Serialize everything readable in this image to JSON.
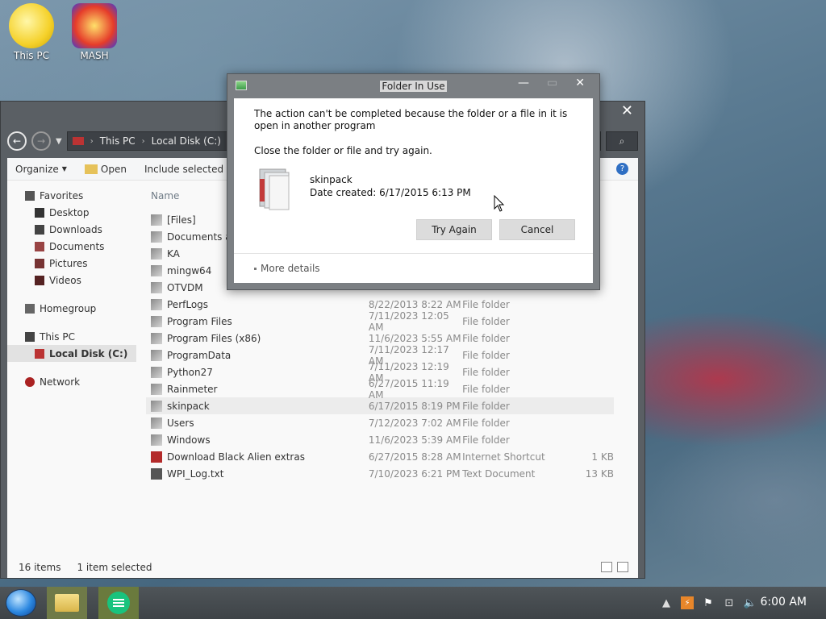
{
  "desktop": {
    "icons": [
      {
        "label": "This PC"
      },
      {
        "label": "MASH"
      }
    ]
  },
  "explorer": {
    "close_glyph": "✕",
    "address": {
      "crumbs": [
        "This PC",
        "Local Disk (C:)"
      ],
      "sep": "›"
    },
    "toolbar": {
      "organize": "Organize",
      "open": "Open",
      "include": "Include selected"
    },
    "nav": {
      "favorites": "Favorites",
      "desktop": "Desktop",
      "downloads": "Downloads",
      "documents": "Documents",
      "pictures": "Pictures",
      "videos": "Videos",
      "homegroup": "Homegroup",
      "this_pc": "This PC",
      "local_disk": "Local Disk (C:)",
      "network": "Network"
    },
    "columns": {
      "name": "Name"
    },
    "files": [
      {
        "name": "[Files]",
        "date": "",
        "type": "",
        "size": ""
      },
      {
        "name": "Documents and Settings",
        "date": "",
        "type": "",
        "size": ""
      },
      {
        "name": "KA",
        "date": "",
        "type": "",
        "size": ""
      },
      {
        "name": "mingw64",
        "date": "",
        "type": "",
        "size": ""
      },
      {
        "name": "OTVDM",
        "date": "",
        "type": "",
        "size": ""
      },
      {
        "name": "PerfLogs",
        "date": "8/22/2013 8:22 AM",
        "type": "File folder",
        "size": ""
      },
      {
        "name": "Program Files",
        "date": "7/11/2023 12:05 AM",
        "type": "File folder",
        "size": ""
      },
      {
        "name": "Program Files (x86)",
        "date": "11/6/2023 5:55 AM",
        "type": "File folder",
        "size": ""
      },
      {
        "name": "ProgramData",
        "date": "7/11/2023 12:17 AM",
        "type": "File folder",
        "size": ""
      },
      {
        "name": "Python27",
        "date": "7/11/2023 12:19 AM",
        "type": "File folder",
        "size": ""
      },
      {
        "name": "Rainmeter",
        "date": "6/27/2015 11:19 AM",
        "type": "File folder",
        "size": ""
      },
      {
        "name": "skinpack",
        "date": "6/17/2015 8:19 PM",
        "type": "File folder",
        "size": ""
      },
      {
        "name": "Users",
        "date": "7/12/2023 7:02 AM",
        "type": "File folder",
        "size": ""
      },
      {
        "name": "Windows",
        "date": "11/6/2023 5:39 AM",
        "type": "File folder",
        "size": ""
      },
      {
        "name": "Download Black Alien extras",
        "date": "6/27/2015 8:28 AM",
        "type": "Internet Shortcut",
        "size": "1 KB"
      },
      {
        "name": "WPI_Log.txt",
        "date": "7/10/2023 6:21 PM",
        "type": "Text Document",
        "size": "13 KB"
      }
    ],
    "status": {
      "count": "16 items",
      "selected": "1 item selected"
    }
  },
  "dialog": {
    "title": "Folder In Use",
    "message": "The action can't be completed because the folder or a file in it is open in another program",
    "instruction": "Close the folder or file and try again.",
    "item_name": "skinpack",
    "item_date": "Date created: 6/17/2015 6:13 PM",
    "try_again": "Try Again",
    "cancel": "Cancel",
    "more_details": "More details",
    "minimize_glyph": "—",
    "maximize_glyph": "▭",
    "close_glyph": "✕"
  },
  "taskbar": {
    "clock": "6:00 AM"
  },
  "colors": {
    "accent_blue": "#2f6fc3",
    "explorer_chrome": "#5a5f64",
    "dialog_chrome": "#7b7f83",
    "taskbar": "#4f5559"
  }
}
